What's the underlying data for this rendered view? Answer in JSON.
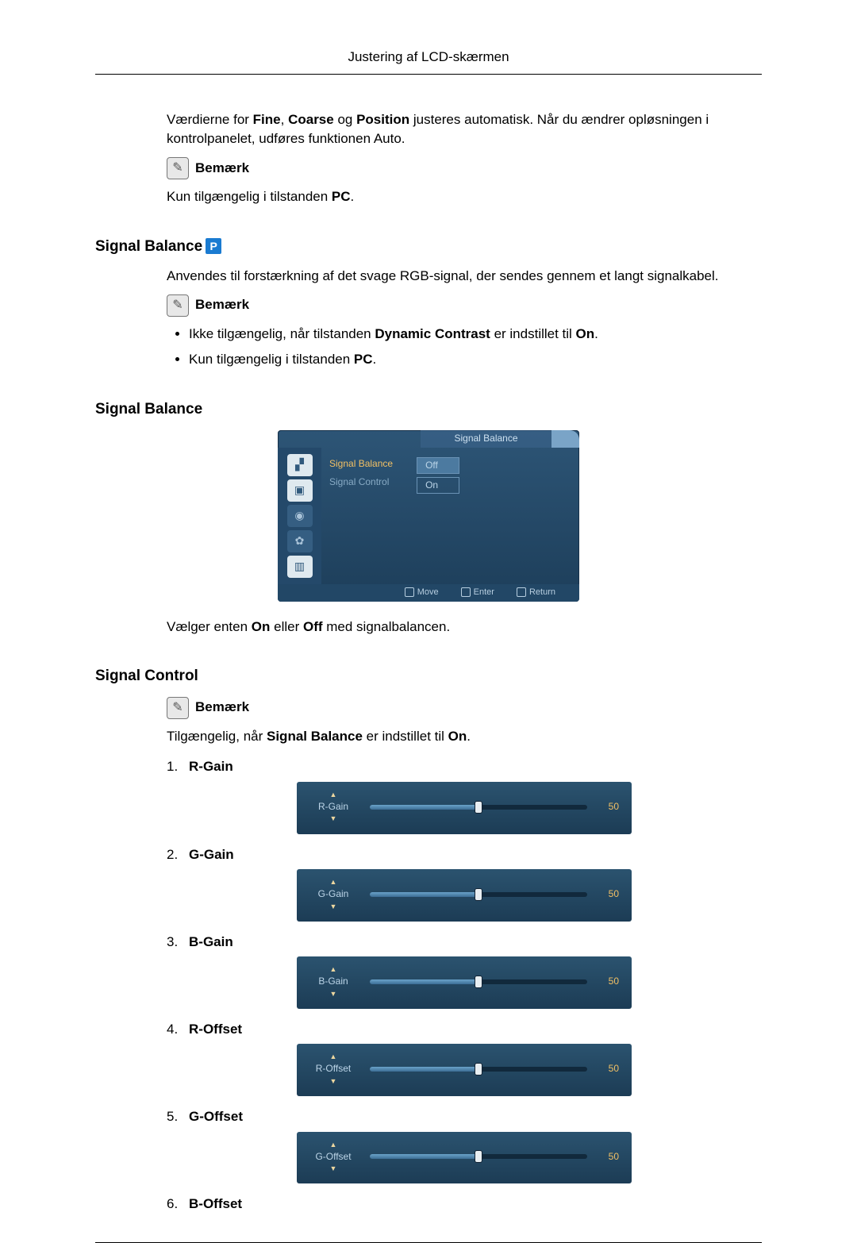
{
  "header": {
    "title": "Justering af LCD-skærmen"
  },
  "intro": {
    "text_before": "Værdierne for ",
    "b1": "Fine",
    "sep1": ", ",
    "b2": "Coarse",
    "sep2": " og ",
    "b3": "Position",
    "text_after": " justeres automatisk. Når du ændrer opløsningen i kontrolpanelet, udføres funktionen Auto."
  },
  "note_label": "Bemærk",
  "note1_text_before": "Kun tilgængelig i tilstanden ",
  "note1_bold": "PC",
  "note1_after": ".",
  "section_signal_balance": "Signal Balance",
  "p_badge": "P",
  "sb_intro": "Anvendes til forstærkning af det svage RGB-signal, der sendes gennem et langt signalkabel.",
  "sb_bullet1_before": "Ikke tilgængelig, når tilstanden ",
  "sb_bullet1_bold": "Dynamic Contrast",
  "sb_bullet1_mid": " er indstillet til ",
  "sb_bullet1_bold2": "On",
  "sb_bullet1_after": ".",
  "sb_bullet2_before": "Kun tilgængelig i tilstanden ",
  "sb_bullet2_bold": "PC",
  "sb_bullet2_after": ".",
  "section_signal_balance2": "Signal Balance",
  "osd": {
    "title": "Signal Balance",
    "row1": "Signal Balance",
    "row2": "Signal Control",
    "val_off": "Off",
    "val_on": "On",
    "footer_move": "Move",
    "footer_enter": "Enter",
    "footer_return": "Return"
  },
  "sb_choose_before": "Vælger enten ",
  "sb_choose_on": "On",
  "sb_choose_mid": " eller ",
  "sb_choose_off": "Off",
  "sb_choose_after": " med signalbalancen.",
  "section_signal_control": "Signal Control",
  "sc_note_before": "Tilgængelig, når ",
  "sc_note_bold": "Signal Balance",
  "sc_note_mid": " er indstillet til ",
  "sc_note_bold2": "On",
  "sc_note_after": ".",
  "sc": {
    "items": [
      {
        "num": "1.",
        "label": "R-Gain",
        "slider": "R-Gain",
        "value": "50"
      },
      {
        "num": "2.",
        "label": "G-Gain",
        "slider": "G-Gain",
        "value": "50"
      },
      {
        "num": "3.",
        "label": "B-Gain",
        "slider": "B-Gain",
        "value": "50"
      },
      {
        "num": "4.",
        "label": "R-Offset",
        "slider": "R-Offset",
        "value": "50"
      },
      {
        "num": "5.",
        "label": "G-Offset",
        "slider": "G-Offset",
        "value": "50"
      },
      {
        "num": "6.",
        "label": "B-Offset",
        "slider": "",
        "value": ""
      }
    ]
  }
}
